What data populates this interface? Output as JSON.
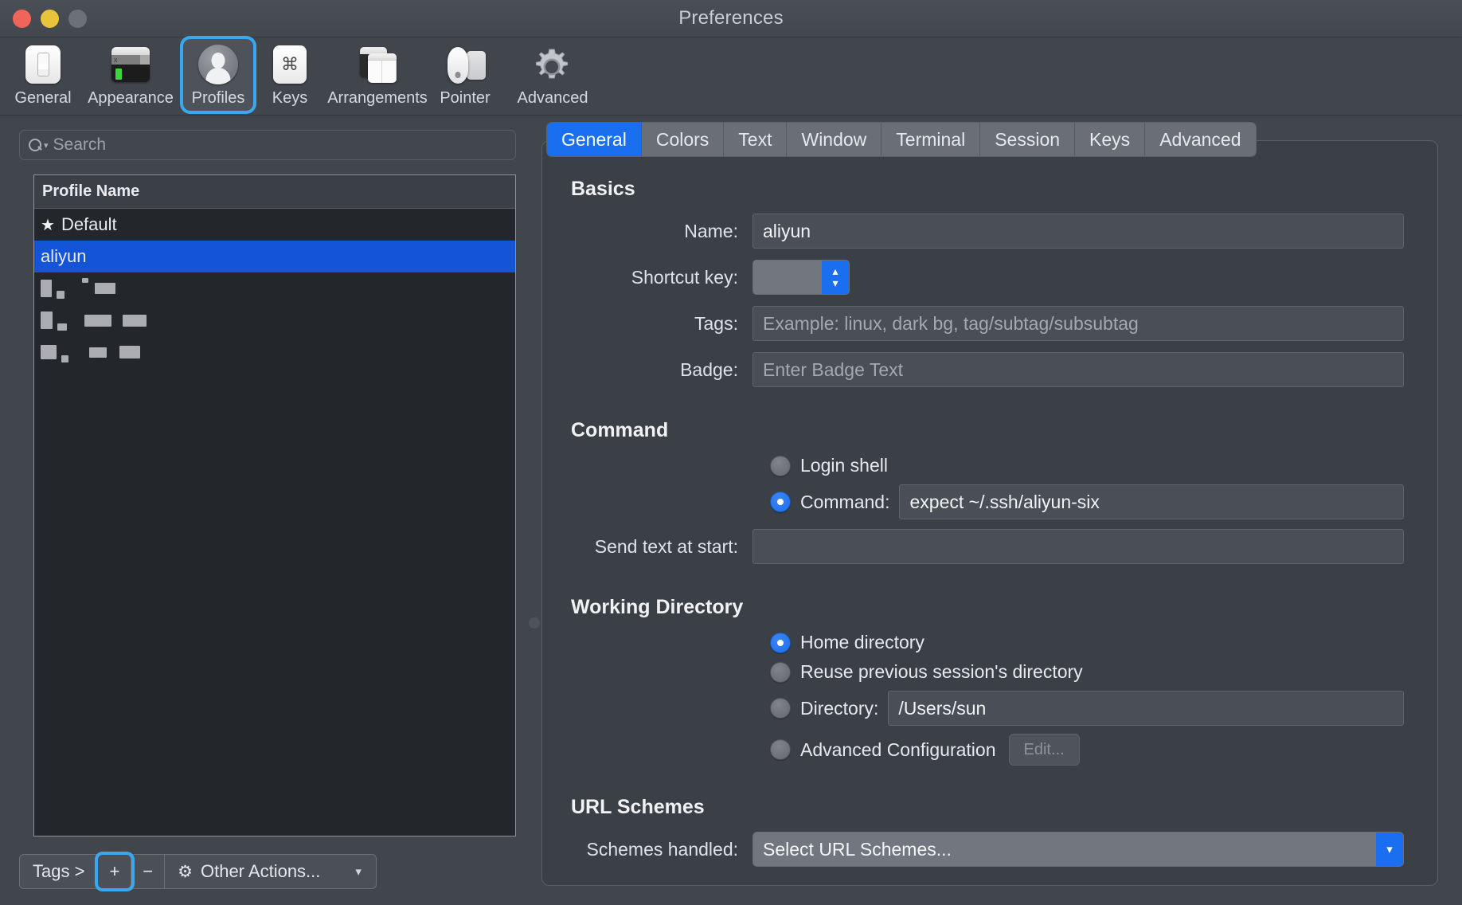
{
  "window": {
    "title": "Preferences",
    "traffic_lights": [
      "close-button",
      "minimize-button",
      "zoom-button"
    ]
  },
  "toolbar": {
    "items": [
      {
        "label": "General",
        "icon": "toggle-switch-icon",
        "selected": false
      },
      {
        "label": "Appearance",
        "icon": "terminal-window-icon",
        "selected": false
      },
      {
        "label": "Profiles",
        "icon": "person-icon",
        "selected": true
      },
      {
        "label": "Keys",
        "icon": "command-key-icon",
        "selected": false
      },
      {
        "label": "Arrangements",
        "icon": "stacked-windows-icon",
        "selected": false
      },
      {
        "label": "Pointer",
        "icon": "mouse-icon",
        "selected": false
      },
      {
        "label": "Advanced",
        "icon": "gear-icon",
        "selected": false
      }
    ],
    "selected_accent": "#3aa8f0"
  },
  "sidebar": {
    "search": {
      "placeholder": "Search",
      "value": "",
      "icon": "search-icon"
    },
    "list": {
      "column_header": "Profile Name",
      "rows": [
        {
          "name": "Default",
          "starred": true,
          "selected": false,
          "redacted": false
        },
        {
          "name": "aliyun",
          "starred": false,
          "selected": true,
          "redacted": false
        },
        {
          "name": "",
          "starred": false,
          "selected": false,
          "redacted": true
        },
        {
          "name": "",
          "starred": false,
          "selected": false,
          "redacted": true
        },
        {
          "name": "",
          "starred": false,
          "selected": false,
          "redacted": true
        }
      ],
      "selection_color": "#1355d6"
    },
    "bottom_bar": {
      "tags_label": "Tags >",
      "add_label": "+",
      "remove_label": "−",
      "other_actions_label": "Other Actions...",
      "other_actions_icon": "gear-icon",
      "chevron_icon": "chevron-down-icon",
      "add_highlighted": true
    }
  },
  "tabs": {
    "items": [
      "General",
      "Colors",
      "Text",
      "Window",
      "Terminal",
      "Session",
      "Keys",
      "Advanced"
    ],
    "active": "General",
    "active_color": "#1a6ef0"
  },
  "panel": {
    "basics": {
      "title": "Basics",
      "name_label": "Name:",
      "name_value": "aliyun",
      "shortcut_label": "Shortcut key:",
      "shortcut_value": "",
      "tags_label": "Tags:",
      "tags_placeholder": "Example: linux, dark bg, tag/subtag/subsubtag",
      "tags_value": "",
      "badge_label": "Badge:",
      "badge_placeholder": "Enter Badge Text",
      "badge_value": ""
    },
    "command": {
      "title": "Command",
      "login_shell_label": "Login shell",
      "login_shell_selected": false,
      "command_label": "Command:",
      "command_selected": true,
      "command_value": "expect ~/.ssh/aliyun-six",
      "send_text_label": "Send text at start:",
      "send_text_value": ""
    },
    "working_directory": {
      "title": "Working Directory",
      "home_label": "Home directory",
      "home_selected": true,
      "reuse_label": "Reuse previous session's directory",
      "reuse_selected": false,
      "directory_label": "Directory:",
      "directory_selected": false,
      "directory_value": "/Users/sun",
      "advanced_label": "Advanced Configuration",
      "advanced_selected": false,
      "edit_button_label": "Edit...",
      "edit_button_disabled": true
    },
    "url_schemes": {
      "title": "URL Schemes",
      "schemes_label": "Schemes handled:",
      "schemes_value": "Select URL Schemes...",
      "chevron_icon": "chevron-down-icon"
    }
  }
}
